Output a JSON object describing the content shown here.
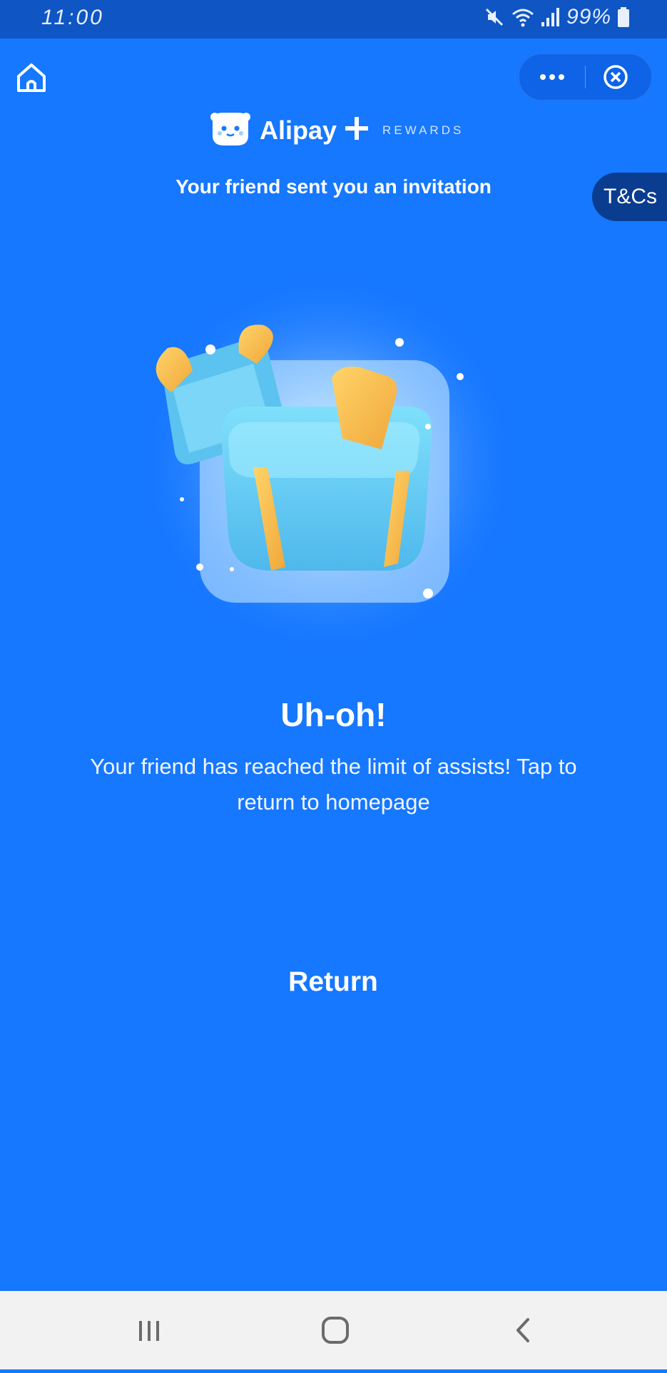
{
  "status_bar": {
    "time": "11:00",
    "battery_text": "99%",
    "icons": [
      "mute-icon",
      "wifi-icon",
      "signal-icon",
      "battery-icon"
    ]
  },
  "top_bar": {
    "icons": [
      "home-icon",
      "more-dots-icon",
      "close-circle-icon"
    ]
  },
  "brand": {
    "name": "Alipay",
    "rewards_label": "REWARDS"
  },
  "subtitle": "Your friend sent you an invitation",
  "tcs_label": "T&Cs",
  "error": {
    "title": "Uh-oh!",
    "message": "Your friend has reached the limit of assists! Tap to return to homepage"
  },
  "return_label": "Return",
  "nav_bar": {
    "icons": [
      "recents-icon",
      "home-circle-icon",
      "back-icon"
    ]
  },
  "colors": {
    "background": "#1677ff",
    "status_bar": "#0f55c4",
    "tcs_background": "#0a3d8f",
    "gift_blue": "#6cd3f7",
    "ribbon_orange": "#f5b94a",
    "nav_bar": "#f2f2f2"
  }
}
